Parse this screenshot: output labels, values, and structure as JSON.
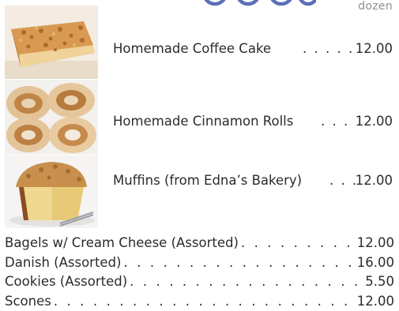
{
  "header": {
    "unit": "dozen"
  },
  "featured": [
    {
      "name": "Homemade Coffee Cake",
      "leader": ". . . . .",
      "price": "12.00",
      "photo": "coffee-cake-photo"
    },
    {
      "name": "Homemade Cinnamon Rolls",
      "leader": ". . .",
      "price": "12.00",
      "photo": "cinnamon-rolls-photo"
    },
    {
      "name": "Muffins (from Edna’s Bakery)",
      "leader": ". . .",
      "price": "12.00",
      "photo": "muffin-photo"
    }
  ],
  "items": [
    {
      "name": "Bagels w/ Cream Cheese (Assorted)",
      "price": "12.00"
    },
    {
      "name": "Danish (Assorted)",
      "price": "16.00"
    },
    {
      "name": "Cookies (Assorted)",
      "price": "5.50"
    },
    {
      "name": "Scones",
      "price": "12.00"
    }
  ],
  "colors": {
    "heading": "#5b6fb8",
    "text": "#2b2b2b",
    "unit": "#8a8f96"
  }
}
